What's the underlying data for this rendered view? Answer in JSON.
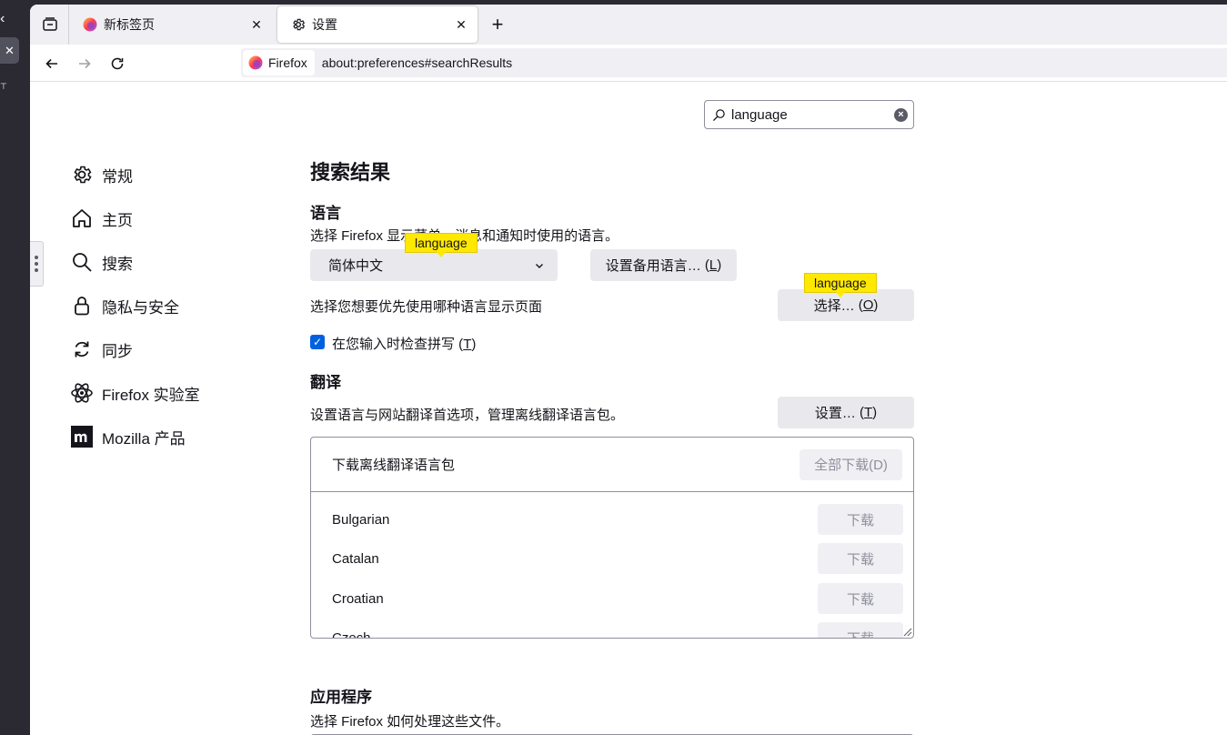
{
  "tabs": [
    {
      "title": "新标签页",
      "active": false,
      "icon": "firefox-logo-icon"
    },
    {
      "title": "设置",
      "active": true,
      "icon": "gear-icon"
    }
  ],
  "urlbar": {
    "identity_label": "Firefox",
    "url": "about:preferences#searchResults"
  },
  "search": {
    "value": "language"
  },
  "sidebar": {
    "items": [
      {
        "label": "常规",
        "icon": "gear-icon"
      },
      {
        "label": "主页",
        "icon": "home-icon"
      },
      {
        "label": "搜索",
        "icon": "search-icon"
      },
      {
        "label": "隐私与安全",
        "icon": "lock-icon"
      },
      {
        "label": "同步",
        "icon": "sync-icon"
      },
      {
        "label": "Firefox 实验室",
        "icon": "atom-icon"
      },
      {
        "label": "Mozilla 产品",
        "icon": "mozilla-icon"
      }
    ]
  },
  "main": {
    "title": "搜索结果",
    "language": {
      "heading": "语言",
      "desc": "选择 Firefox 显示菜单、消息和通知时使用的语言。",
      "selected_language": "简体中文",
      "alt_button": "设置备用语言…",
      "alt_key": "L",
      "page_lang_desc": "选择您想要优先使用哪种语言显示页面",
      "choose_button": "选择…",
      "choose_key": "O",
      "spellcheck_label": "在您输入时检查拼写",
      "spellcheck_key": "T",
      "spellcheck_checked": true,
      "highlight_text": "language"
    },
    "translation": {
      "heading": "翻译",
      "desc": "设置语言与网站翻译首选项，管理离线翻译语言包。",
      "settings_button": "设置…",
      "settings_key": "T",
      "panel_title": "下载离线翻译语言包",
      "download_all": "全部下载(D)",
      "download_label": "下载",
      "languages": [
        "Bulgarian",
        "Catalan",
        "Croatian",
        "Czech"
      ]
    },
    "applications": {
      "heading": "应用程序",
      "desc": "选择 Firefox 如何处理这些文件。"
    }
  },
  "colors": {
    "accent": "#0061e0",
    "highlight": "#ffe900",
    "button_bg": "#e9e9ed"
  }
}
